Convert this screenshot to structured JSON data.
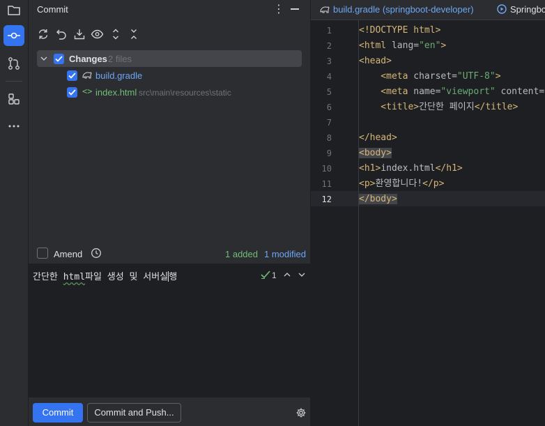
{
  "toolwindow": {
    "title": "Commit"
  },
  "changes": {
    "group_label": "Changes",
    "group_count": "2 files",
    "files": [
      {
        "name": "build.gradle",
        "path": ""
      },
      {
        "name": "index.html",
        "path": "src\\main\\resources\\static"
      }
    ]
  },
  "amend": {
    "label": "Amend"
  },
  "summary": {
    "added": "1 added",
    "modified": "1 modified"
  },
  "message": {
    "text_a": "간단한 ",
    "text_squiggle": "html",
    "text_b": "파일 생성 및 서버실",
    "text_c": "행",
    "check_count": "1"
  },
  "buttons": {
    "commit": "Commit",
    "commit_push": "Commit and Push..."
  },
  "editor": {
    "tabs": [
      {
        "label": "build.gradle (springboot-developer)"
      },
      {
        "label": "Springbo"
      }
    ],
    "line_numbers": [
      "1",
      "2",
      "3",
      "4",
      "5",
      "6",
      "7",
      "8",
      "9",
      "10",
      "11",
      "12"
    ],
    "code": {
      "l1": "<!DOCTYPE html>",
      "l2a": "<html ",
      "l2b": "lang=",
      "l2c": "\"en\"",
      "l2d": ">",
      "l3": "<head>",
      "l4a": "    <meta ",
      "l4b": "charset=",
      "l4c": "\"UTF-8\"",
      "l4d": ">",
      "l5a": "    <meta ",
      "l5b": "name=",
      "l5c": "\"viewport\"",
      "l5d": " content=",
      "l6a": "    <title>",
      "l6b": "간단한 페이지",
      "l6c": "</title>",
      "l8": "</head>",
      "l9": "<body>",
      "l10a": "<h1>",
      "l10b": "index.html",
      "l10c": "</h1>",
      "l11a": "<p>",
      "l11b": "환영합니다!",
      "l11c": "</p>",
      "l12": "</body>"
    }
  },
  "colors": {
    "accent": "#3574f0",
    "added": "#73bd79",
    "modified": "#6ea7f5",
    "tag": "#d5b778",
    "string": "#6aab73"
  }
}
